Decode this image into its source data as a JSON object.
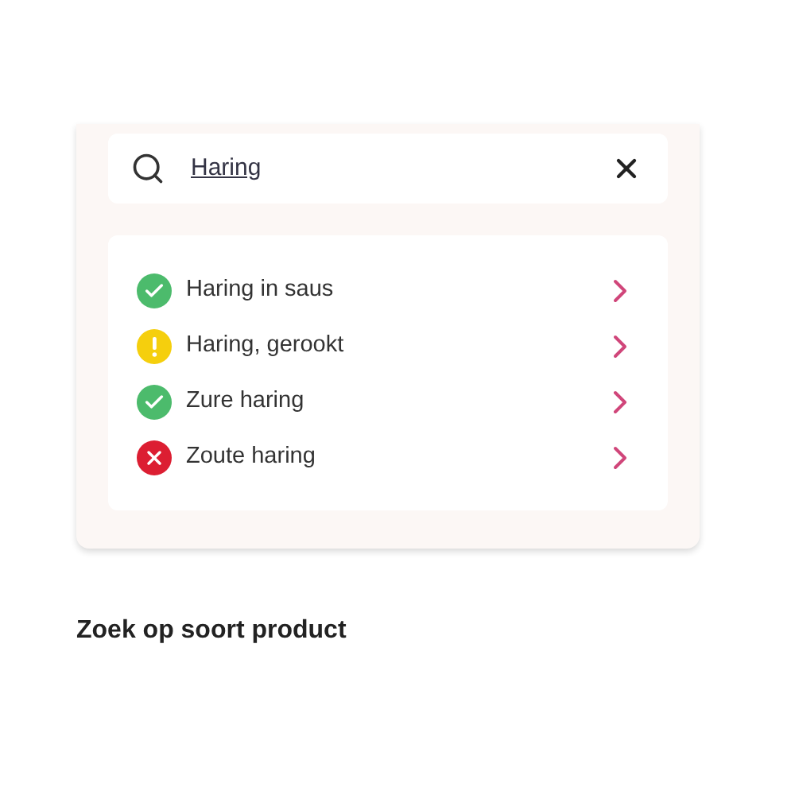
{
  "search": {
    "value": "Haring"
  },
  "results": [
    {
      "label": "Haring in saus",
      "kind": "ok"
    },
    {
      "label": "Haring, gerookt",
      "kind": "warning"
    },
    {
      "label": "Zure haring",
      "kind": "ok"
    },
    {
      "label": "Zoute haring",
      "kind": "bad"
    }
  ],
  "section_title": "Zoek op soort product"
}
